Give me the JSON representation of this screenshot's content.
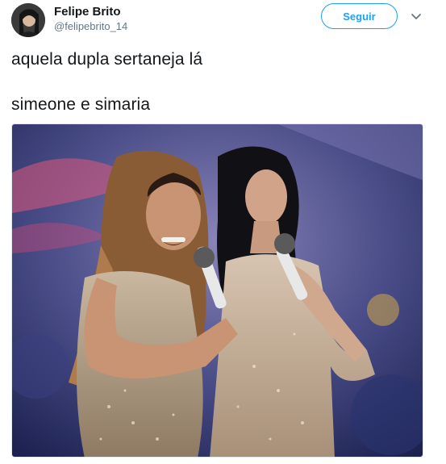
{
  "user": {
    "display_name": "Felipe Brito",
    "handle": "@felipebrito_14"
  },
  "actions": {
    "follow_label": "Seguir"
  },
  "tweet": {
    "lines": [
      "aquela dupla sertaneja lá",
      "simeone e simaria"
    ]
  },
  "icons": {
    "menu": "chevron-down-icon"
  },
  "colors": {
    "accent": "#1da1f2",
    "text": "#14171a",
    "secondary_text": "#657786"
  }
}
